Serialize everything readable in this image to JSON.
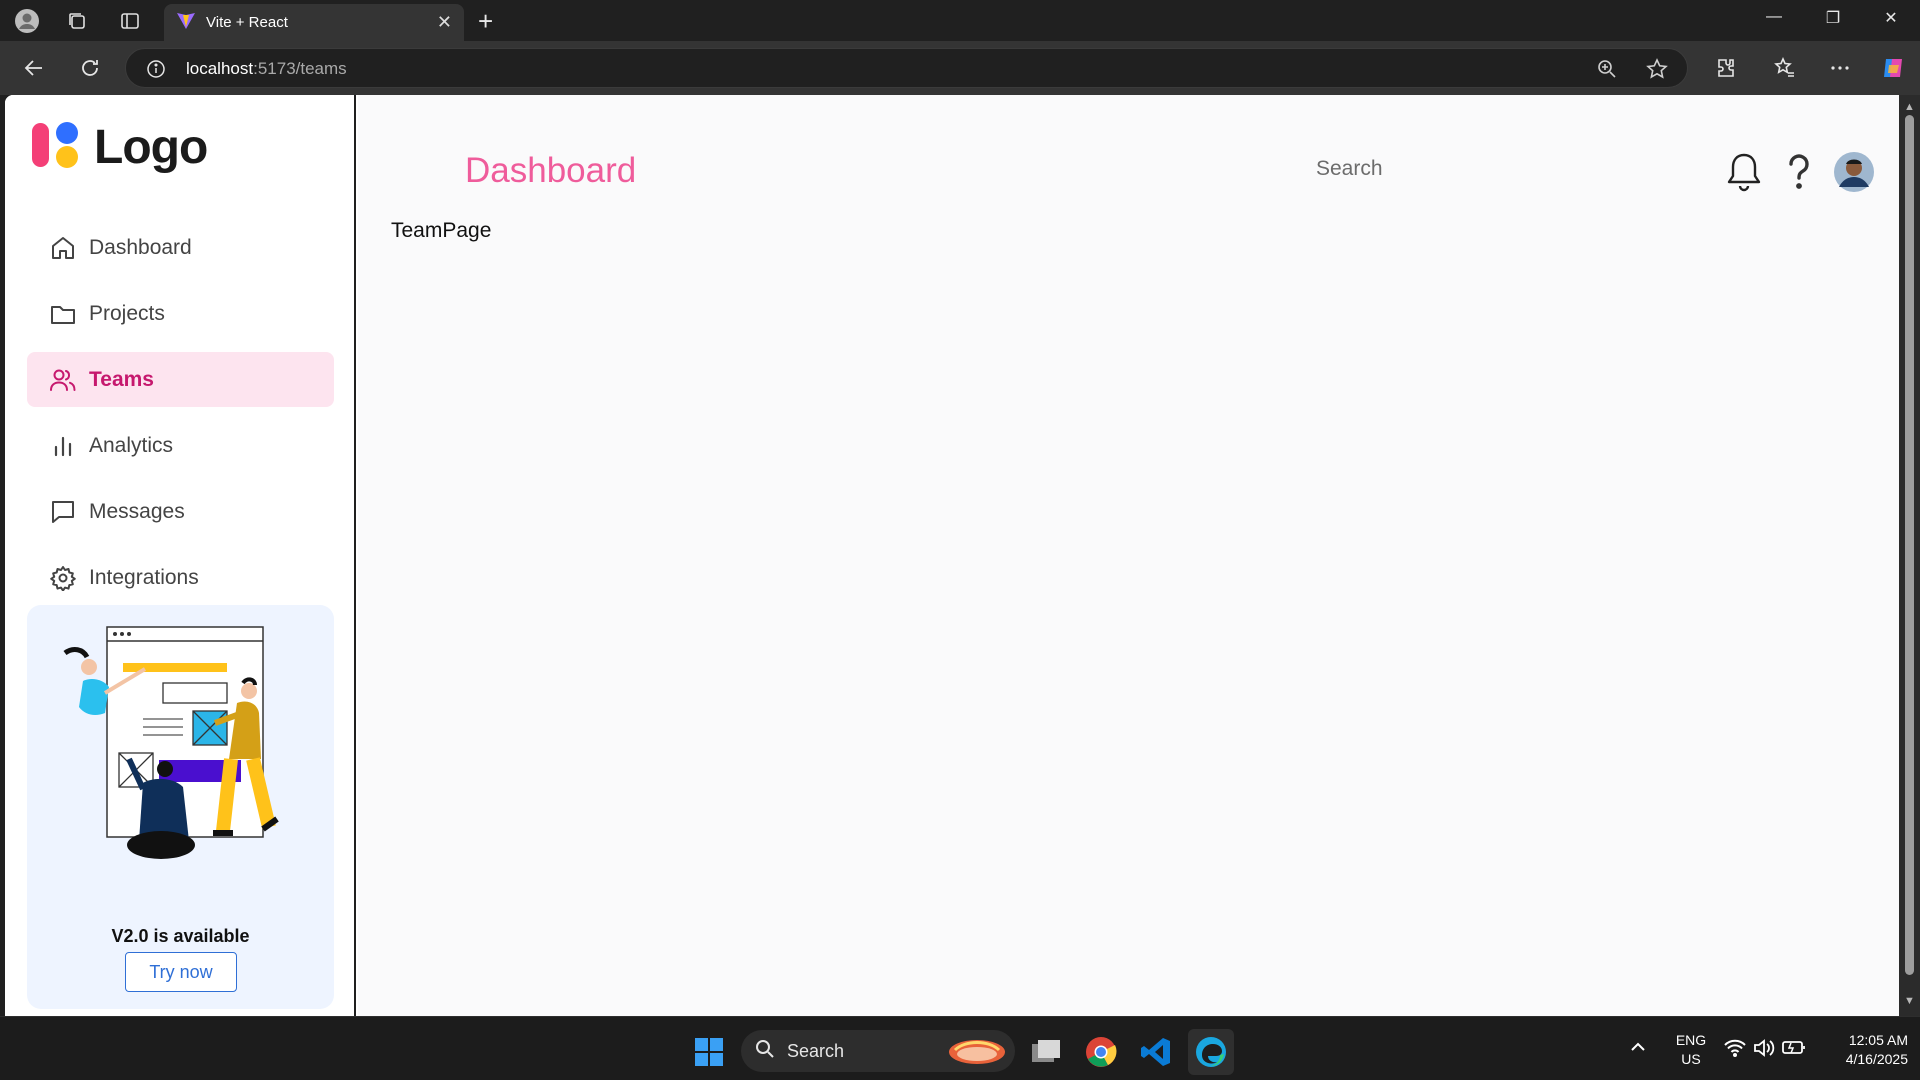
{
  "browser": {
    "tab_title": "Vite + React",
    "tab_close": "✕",
    "new_tab": "+",
    "url_host": "localhost",
    "url_path": ":5173/teams",
    "controls": {
      "minimize": "—",
      "maximize": "❐",
      "close": "✕"
    }
  },
  "sidebar": {
    "logo_text": "Logo",
    "items": [
      {
        "label": "Dashboard",
        "icon": "home-icon",
        "active": false
      },
      {
        "label": "Projects",
        "icon": "folder-icon",
        "active": false
      },
      {
        "label": "Teams",
        "icon": "users-icon",
        "active": true
      },
      {
        "label": "Analytics",
        "icon": "bar-chart-icon",
        "active": false
      },
      {
        "label": "Messages",
        "icon": "chat-icon",
        "active": false
      },
      {
        "label": "Integrations",
        "icon": "gear-icon",
        "active": false
      }
    ],
    "promo": {
      "title": "V2.0 is available",
      "button": "Try now"
    }
  },
  "header": {
    "title": "Dashboard",
    "search_placeholder": "Search"
  },
  "content": {
    "text": "TeamPage"
  },
  "taskbar": {
    "search_label": "Search",
    "language": "ENG",
    "region": "US",
    "time": "12:05 AM",
    "date": "4/16/2025"
  },
  "colors": {
    "accent_pink": "#ef5c9b",
    "active_bg": "#fde4ef",
    "active_text": "#c6186e",
    "promo_bg": "#eef4ff",
    "button_blue": "#2f6fd6"
  }
}
